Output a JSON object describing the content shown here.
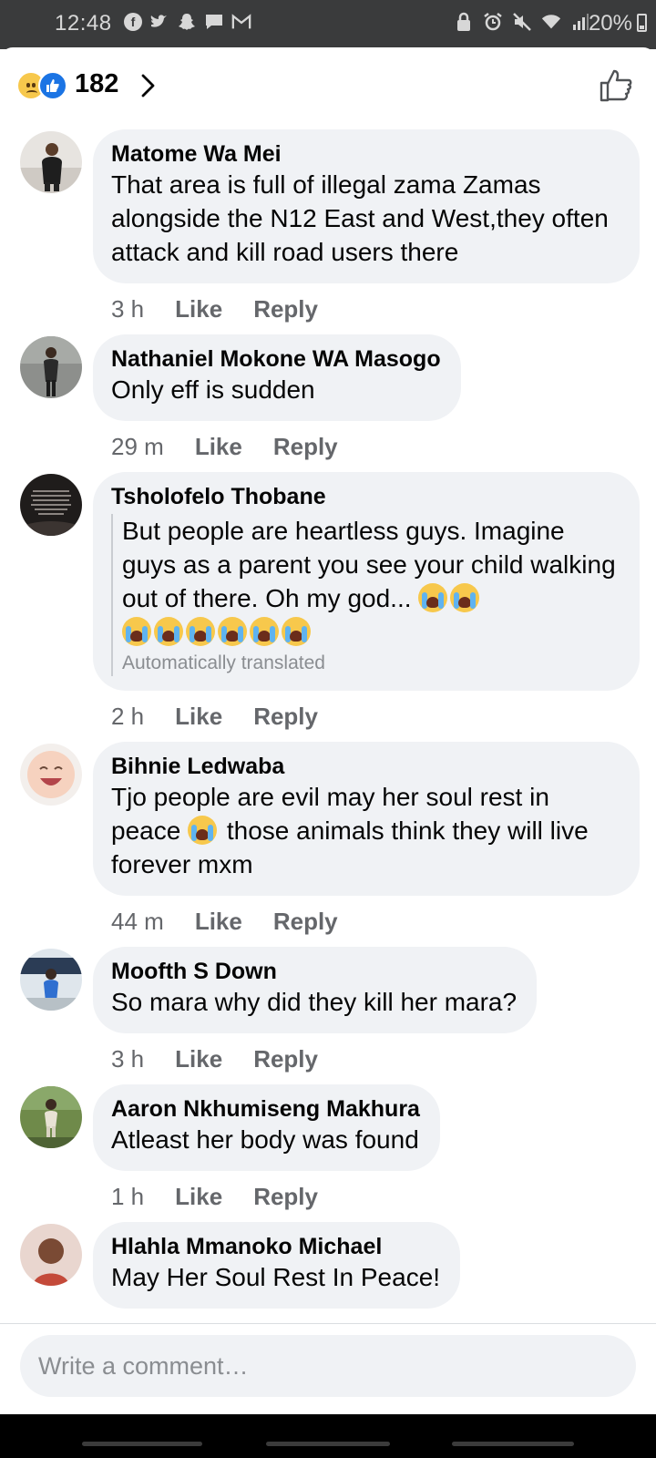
{
  "status_bar": {
    "time": "12:48",
    "battery": "20%",
    "left_icons": [
      "facebook-icon",
      "twitter-icon",
      "snapchat-icon",
      "message-icon",
      "gmail-icon"
    ],
    "right_icons": [
      "lock-icon",
      "alarm-icon",
      "mute-icon",
      "wifi-icon",
      "signal-icon"
    ]
  },
  "reactions": {
    "count": "182",
    "icons": [
      "sad-reaction-icon",
      "like-reaction-icon"
    ]
  },
  "comments": [
    {
      "author": "Matome Wa Mei",
      "text": "That area is full of illegal zama Zamas alongside the N12 East and West,they often attack and kill road users there",
      "time": "3 h",
      "like": "Like",
      "reply": "Reply"
    },
    {
      "author": "Nathaniel Mokone WA Masogo",
      "text": "Only eff is sudden",
      "time": "29 m",
      "like": "Like",
      "reply": "Reply"
    },
    {
      "author": "Tsholofelo Thobane",
      "text": "But people are heartless guys. Imagine guys as a parent you see your child walking out of there. Oh my god...",
      "translated_note": "Automatically translated",
      "time": "2 h",
      "like": "Like",
      "reply": "Reply"
    },
    {
      "author": "Bihnie Ledwaba",
      "text_a": "Tjo people are evil may her soul rest in peace",
      "text_b": "those animals think they will live forever mxm",
      "time": "44 m",
      "like": "Like",
      "reply": "Reply"
    },
    {
      "author": "Moofth S Down",
      "text": "So mara why did they kill her mara?",
      "time": "3 h",
      "like": "Like",
      "reply": "Reply"
    },
    {
      "author": "Aaron Nkhumiseng Makhura",
      "text": "Atleast her body was found",
      "time": "1 h",
      "like": "Like",
      "reply": "Reply"
    },
    {
      "author": "Hlahla Mmanoko Michael",
      "text": "May Her Soul Rest In Peace!"
    }
  ],
  "composer": {
    "placeholder": "Write a comment…"
  },
  "colors": {
    "bubble": "#f0f2f5",
    "meta": "#65676b",
    "like_blue": "#1b74e4",
    "status_bar": "#3a3b3c"
  }
}
